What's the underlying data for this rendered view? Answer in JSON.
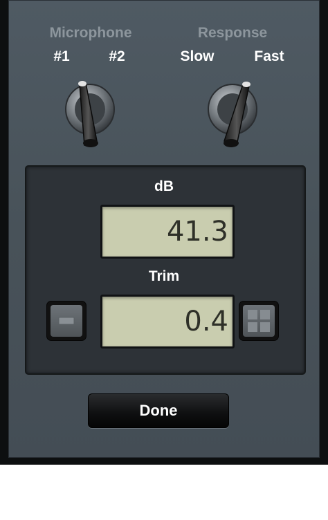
{
  "microphone": {
    "label": "Microphone",
    "option_left": "#1",
    "option_right": "#2",
    "selected": "#2"
  },
  "response": {
    "label": "Response",
    "option_left": "Slow",
    "option_right": "Fast",
    "selected": "Fast"
  },
  "db": {
    "label": "dB",
    "value": "41.3"
  },
  "trim": {
    "label": "Trim",
    "value": "0.4"
  },
  "buttons": {
    "done_label": "Done"
  },
  "colors": {
    "panel": "#4f5a63",
    "lcd": "#c9cdaf",
    "group_label": "#8d969d"
  },
  "icons": {
    "decrease": "minus-icon",
    "increase": "plus-icon"
  }
}
